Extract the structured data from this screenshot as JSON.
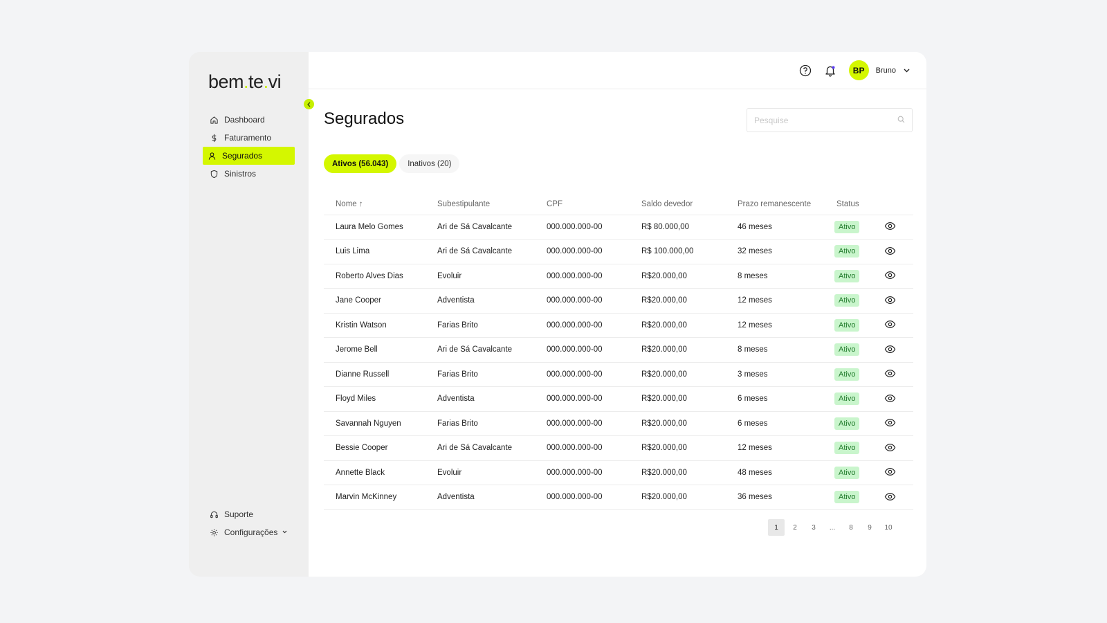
{
  "app": {
    "logo_parts": [
      "bem",
      ".",
      "te",
      ".",
      "vi"
    ],
    "accent_color": "#d4f700"
  },
  "sidebar": {
    "items": [
      {
        "label": "Dashboard",
        "icon": "home-icon"
      },
      {
        "label": "Faturamento",
        "icon": "dollar-icon"
      },
      {
        "label": "Segurados",
        "icon": "user-icon",
        "active": true
      },
      {
        "label": "Sinistros",
        "icon": "shield-icon"
      }
    ],
    "bottom_items": [
      {
        "label": "Suporte",
        "icon": "headset-icon"
      },
      {
        "label": "Configurações",
        "icon": "gear-icon"
      }
    ]
  },
  "header": {
    "avatar_initials": "BP",
    "user_name": "Bruno"
  },
  "page": {
    "title": "Segurados",
    "search_placeholder": "Pesquise",
    "tabs": [
      {
        "label": "Ativos (56.043)",
        "active": true
      },
      {
        "label": "Inativos (20)",
        "active": false
      }
    ]
  },
  "table": {
    "columns": [
      "Nome ↑",
      "Subestipulante",
      "CPF",
      "Saldo devedor",
      "Prazo remanescente",
      "Status"
    ],
    "rows": [
      [
        "Laura Melo Gomes",
        "Ari de Sá Cavalcante",
        "000.000.000-00",
        "R$ 80.000,00",
        "46 meses",
        "Ativo"
      ],
      [
        "Luis Lima",
        "Ari de Sá Cavalcante",
        "000.000.000-00",
        "R$ 100.000,00",
        "32 meses",
        "Ativo"
      ],
      [
        "Roberto Alves Dias",
        "Evoluir",
        "000.000.000-00",
        "R$20.000,00",
        "8 meses",
        "Ativo"
      ],
      [
        "Jane Cooper",
        "Adventista",
        "000.000.000-00",
        "R$20.000,00",
        "12 meses",
        "Ativo"
      ],
      [
        "Kristin Watson",
        "Farias Brito",
        "000.000.000-00",
        "R$20.000,00",
        "12 meses",
        "Ativo"
      ],
      [
        "Jerome Bell",
        "Ari de Sá Cavalcante",
        "000.000.000-00",
        "R$20.000,00",
        "8 meses",
        "Ativo"
      ],
      [
        "Dianne Russell",
        "Farias Brito",
        "000.000.000-00",
        "R$20.000,00",
        "3 meses",
        "Ativo"
      ],
      [
        "Floyd Miles",
        "Adventista",
        "000.000.000-00",
        "R$20.000,00",
        "6 meses",
        "Ativo"
      ],
      [
        "Savannah Nguyen",
        "Farias Brito",
        "000.000.000-00",
        "R$20.000,00",
        "6 meses",
        "Ativo"
      ],
      [
        "Bessie Cooper",
        "Ari de Sá Cavalcante",
        "000.000.000-00",
        "R$20.000,00",
        "12 meses",
        "Ativo"
      ],
      [
        "Annette Black",
        "Evoluir",
        "000.000.000-00",
        "R$20.000,00",
        "48 meses",
        "Ativo"
      ],
      [
        "Marvin McKinney",
        "Adventista",
        "000.000.000-00",
        "R$20.000,00",
        "36 meses",
        "Ativo"
      ]
    ]
  },
  "pagination": {
    "pages": [
      "1",
      "2",
      "3",
      "...",
      "8",
      "9",
      "10"
    ],
    "current": "1"
  }
}
